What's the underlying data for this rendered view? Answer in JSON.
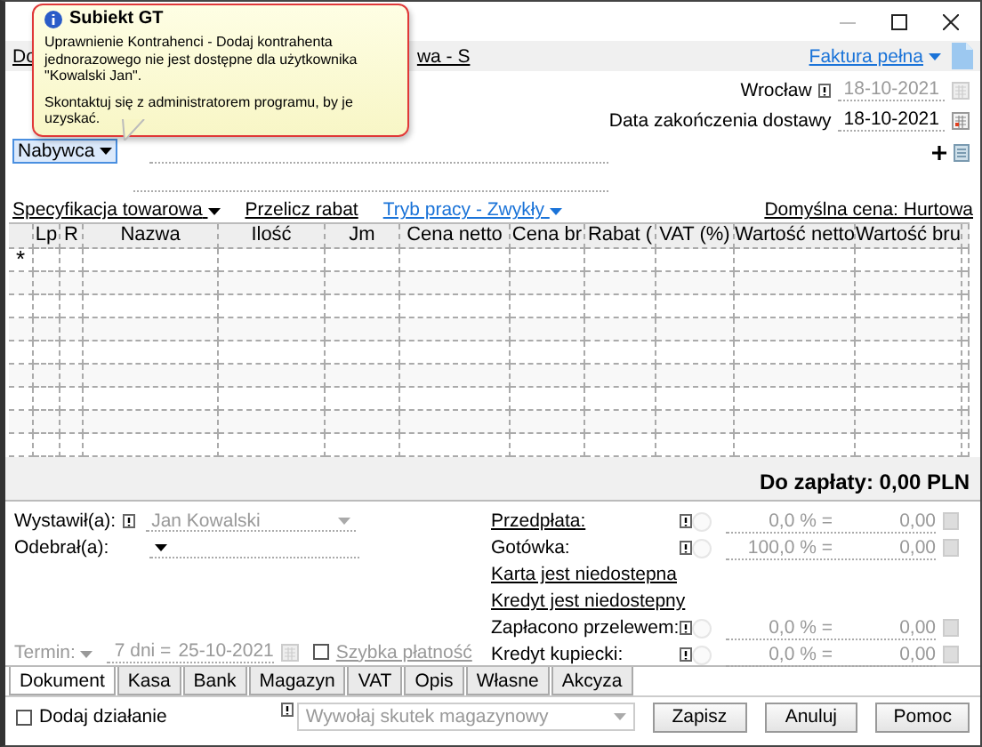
{
  "toolbar": {
    "fragments": [
      "Do",
      "wa - S"
    ],
    "document_type": "Faktura pełna"
  },
  "tooltip": {
    "title": "Subiekt GT",
    "message": "Uprawnienie Kontrahenci - Dodaj kontrahenta jednorazowego nie jest dostępne dla użytkownika \"Kowalski Jan\".",
    "hint": "Skontaktuj się z administratorem programu, by je uzyskać."
  },
  "header": {
    "place": "Wrocław",
    "issue_date": "18-10-2021",
    "delivery_label": "Data zakończenia dostawy",
    "delivery_date": "18-10-2021"
  },
  "buyer": {
    "label": "Nabywca",
    "selected": true
  },
  "spec": {
    "title": "Specyfikacja towarowa",
    "recalc": "Przelicz rabat",
    "mode": "Tryb pracy - Zwykły",
    "price": "Domyślna cena: Hurtowa"
  },
  "table": {
    "columns": [
      "Lp",
      "R",
      "Nazwa",
      "Ilość",
      "Jm",
      "Cena netto",
      "Cena br",
      "Rabat (",
      "VAT (%)",
      "Wartość netto",
      "Wartość bru"
    ],
    "new_row_marker": "*"
  },
  "total": "Do zapłaty: 0,00 PLN",
  "issuer": {
    "label": "Wystawił(a):",
    "value": "Jan Kowalski"
  },
  "receiver": {
    "label": "Odebrał(a):"
  },
  "term": {
    "label": "Termin:",
    "days": "7 dni =",
    "date": "25-10-2021"
  },
  "quick_payment": {
    "label": "Szybka płatność",
    "checked": false
  },
  "payments": [
    {
      "kind": "amount",
      "label": "Przedpłata:",
      "underlined": true,
      "percent": "0,0 % =",
      "amount": "0,00"
    },
    {
      "kind": "amount",
      "label": "Gotówka:",
      "underlined": false,
      "percent": "100,0 % =",
      "amount": "0,00"
    },
    {
      "kind": "link",
      "label": "Karta jest niedostepna"
    },
    {
      "kind": "link",
      "label": "Kredyt jest niedostepny"
    },
    {
      "kind": "amount",
      "label": "Zapłacono przelewem:",
      "underlined": false,
      "percent": "0,0 % =",
      "amount": "0,00"
    },
    {
      "kind": "amount",
      "label": "Kredyt kupiecki:",
      "underlined": false,
      "percent": "0,0 % =",
      "amount": "0,00"
    }
  ],
  "tabs": [
    {
      "label": "Dokument",
      "selected": true
    },
    {
      "label": "Kasa",
      "selected": false
    },
    {
      "label": "Bank",
      "selected": false
    },
    {
      "label": "Magazyn",
      "selected": false
    },
    {
      "label": "VAT",
      "selected": false
    },
    {
      "label": "Opis",
      "selected": false
    },
    {
      "label": "Własne",
      "selected": false
    },
    {
      "label": "Akcyza",
      "selected": false
    }
  ],
  "footer": {
    "add_action": {
      "label": "Dodaj działanie",
      "checked": false
    },
    "effect": {
      "value": "Wywołaj skutek magazynowy",
      "disabled": true
    },
    "buttons": [
      "Zapisz",
      "Anuluj",
      "Pomoc"
    ]
  }
}
